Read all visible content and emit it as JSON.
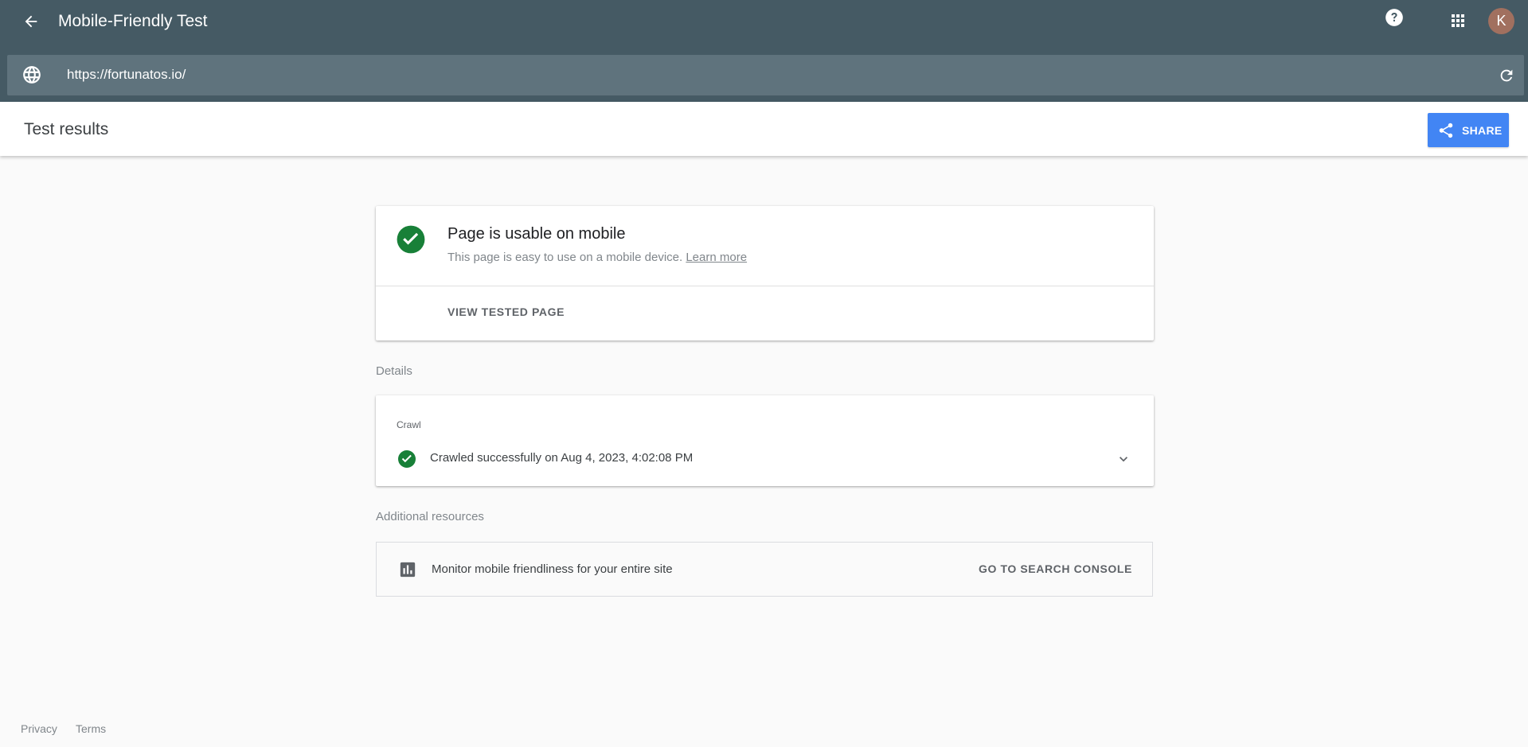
{
  "appbar": {
    "title": "Mobile-Friendly Test",
    "avatar_initial": "K"
  },
  "urlbar": {
    "url": "https://fortunatos.io/"
  },
  "results_header": {
    "title": "Test results",
    "share_label": "SHARE"
  },
  "result": {
    "title": "Page is usable on mobile",
    "subtitle": "This page is easy to use on a mobile device.",
    "learn_more": "Learn more",
    "view_tested_page": "VIEW TESTED PAGE"
  },
  "details": {
    "label": "Details",
    "crawl_label": "Crawl",
    "crawl_status": "Crawled successfully on Aug 4, 2023, 4:02:08 PM"
  },
  "resources": {
    "label": "Additional resources",
    "text": "Monitor mobile friendliness for your entire site",
    "link": "GO TO SEARCH CONSOLE"
  },
  "footer": {
    "privacy": "Privacy",
    "terms": "Terms"
  },
  "colors": {
    "appbar": "#455a64",
    "success": "#188038",
    "share": "#4285f4"
  }
}
